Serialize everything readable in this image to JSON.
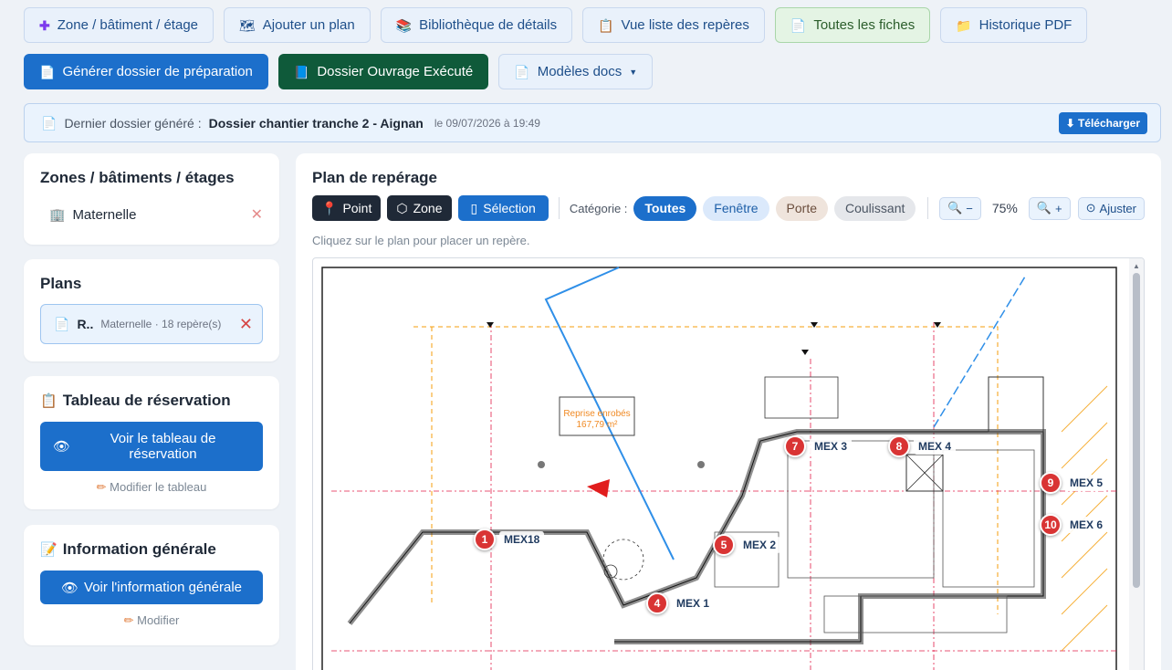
{
  "toolbar": {
    "row1": [
      {
        "icon": "plus-icon",
        "label": "Zone / bâtiment / étage"
      },
      {
        "icon": "map-icon",
        "label": "Ajouter un plan"
      },
      {
        "icon": "books-icon",
        "label": "Bibliothèque de détails"
      },
      {
        "icon": "clipboard-icon",
        "label": "Vue liste des repères"
      },
      {
        "icon": "document-icon",
        "label": "Toutes les fiches"
      },
      {
        "icon": "folder-icon",
        "label": "Historique PDF"
      }
    ],
    "row2": [
      {
        "icon": "document-icon",
        "label": "Générer dossier de préparation"
      },
      {
        "icon": "book-icon",
        "label": "Dossier Ouvrage Exécuté"
      },
      {
        "icon": "document-icon",
        "label": "Modèles docs"
      }
    ]
  },
  "last_file": {
    "label": "Dernier dossier généré :",
    "name": "Dossier chantier tranche 2 - Aignan",
    "date": "le 09/07/2026 à 19:49",
    "download": "⬇ Télécharger"
  },
  "zones": {
    "title": "Zones / bâtiments / étages",
    "items": [
      {
        "label": "Maternelle"
      }
    ]
  },
  "plans": {
    "title": "Plans",
    "items": [
      {
        "name": "R..",
        "meta": "Maternelle · 18 repère(s)"
      }
    ]
  },
  "reservation": {
    "title": "Tableau de réservation",
    "button": "Voir le tableau de réservation",
    "edit": "Modifier le tableau"
  },
  "info": {
    "title": "Information générale",
    "button": "Voir l'information générale",
    "edit": "Modifier"
  },
  "plan_view": {
    "title": "Plan de repérage",
    "modes": [
      "Point",
      "Zone",
      "Sélection"
    ],
    "category_label": "Catégorie :",
    "categories": [
      "Toutes",
      "Fenêtre",
      "Porte",
      "Coulissant"
    ],
    "zoom_out": "−",
    "zoom_level": "75%",
    "zoom_in": "+",
    "fit": "Ajuster",
    "hint": "Cliquez sur le plan pour placer un repère.",
    "annotations": {
      "reprise": "Reprise enrobés",
      "reprise_area": "167,79 m²"
    },
    "markers": [
      {
        "num": "1",
        "label": "MEX18"
      },
      {
        "num": "4",
        "label": "MEX 1"
      },
      {
        "num": "5",
        "label": "MEX 2"
      },
      {
        "num": "7",
        "label": "MEX 3"
      },
      {
        "num": "8",
        "label": "MEX 4"
      },
      {
        "num": "9",
        "label": "MEX 5"
      },
      {
        "num": "10",
        "label": "MEX 6"
      }
    ]
  }
}
